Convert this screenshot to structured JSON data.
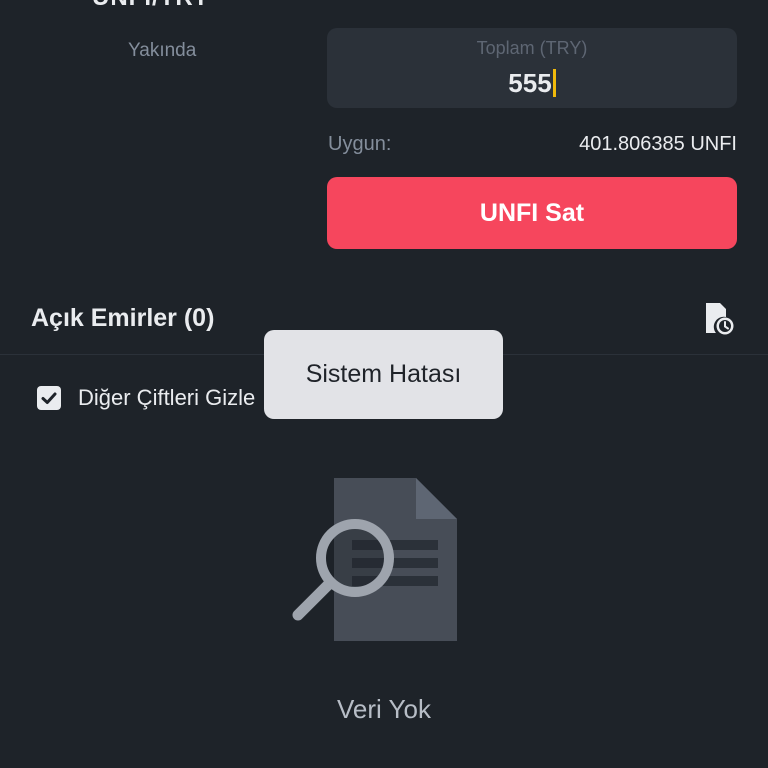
{
  "header": {
    "pair_title": "UNFI/TRY",
    "soon_label": "Yakında"
  },
  "order_form": {
    "total_label": "Toplam (TRY)",
    "total_value": "555",
    "available_label": "Uygun:",
    "available_value": "401.806385 UNFI",
    "sell_button_label": "UNFI Sat"
  },
  "open_orders": {
    "title": "Açık Emirler (0)",
    "hide_other_pairs_label": "Diğer Çiftleri Gizle",
    "hide_other_pairs_checked": true,
    "empty_state_text": "Veri Yok"
  },
  "toast": {
    "message": "Sistem Hatası"
  },
  "icons": {
    "history": "order-history-icon",
    "empty_state": "document-search-icon",
    "checkbox": "checkmark-icon"
  },
  "colors": {
    "background": "#1e2329",
    "field_background": "#2b3139",
    "sell_red": "#f6465d",
    "cursor_yellow": "#f0b90b",
    "text_primary": "#eaecef",
    "text_secondary": "#848e9c",
    "toast_background": "#e2e3e7"
  }
}
